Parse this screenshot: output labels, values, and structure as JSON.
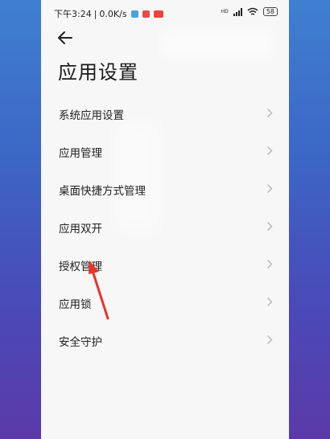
{
  "status_bar": {
    "time": "下午3:24",
    "separator": "|",
    "speed": "0.0K/s",
    "signal": "HD",
    "battery": "58"
  },
  "header": {
    "title": "应用设置"
  },
  "settings": {
    "items": [
      {
        "label": "系统应用设置"
      },
      {
        "label": "应用管理"
      },
      {
        "label": "桌面快捷方式管理"
      },
      {
        "label": "应用双开"
      },
      {
        "label": "授权管理"
      },
      {
        "label": "应用锁"
      },
      {
        "label": "安全守护"
      }
    ]
  },
  "colors": {
    "background_gradient_top": "#3f7fd0",
    "background_gradient_bottom": "#5b3aa8",
    "panel": "#f7f7f8",
    "annotation_arrow": "#e5352a",
    "chevron": "#b5b5b5"
  }
}
